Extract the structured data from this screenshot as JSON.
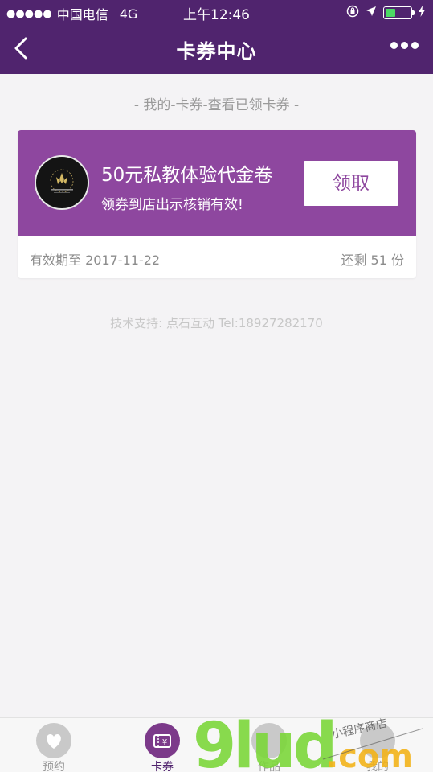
{
  "status_bar": {
    "carrier": "中国电信",
    "network": "4G",
    "time": "上午12:46"
  },
  "nav": {
    "title": "卡券中心"
  },
  "breadcrumb": "- 我的-卡券-查看已领卡券 -",
  "coupon": {
    "name": "50元私教体验代金卷",
    "description": "领券到店出示核销有效!",
    "claim_label": "领取",
    "expiry": "有效期至 2017-11-22",
    "remaining": "还剩 51 份"
  },
  "support_text": "技术支持: 点石互动 Tel:18927282170",
  "tabs": [
    {
      "label": "预约",
      "icon": "heart-icon"
    },
    {
      "label": "卡券",
      "icon": "coupon-icon"
    },
    {
      "label": "作品",
      "icon": "works-icon"
    },
    {
      "label": "我的",
      "icon": "user-icon"
    }
  ],
  "watermark": {
    "text": "9lud.com",
    "caption": "小程序商店"
  },
  "colors": {
    "brand_dark": "#50246e",
    "coupon_purple": "#8e479f",
    "battery_green": "#4cd964"
  }
}
